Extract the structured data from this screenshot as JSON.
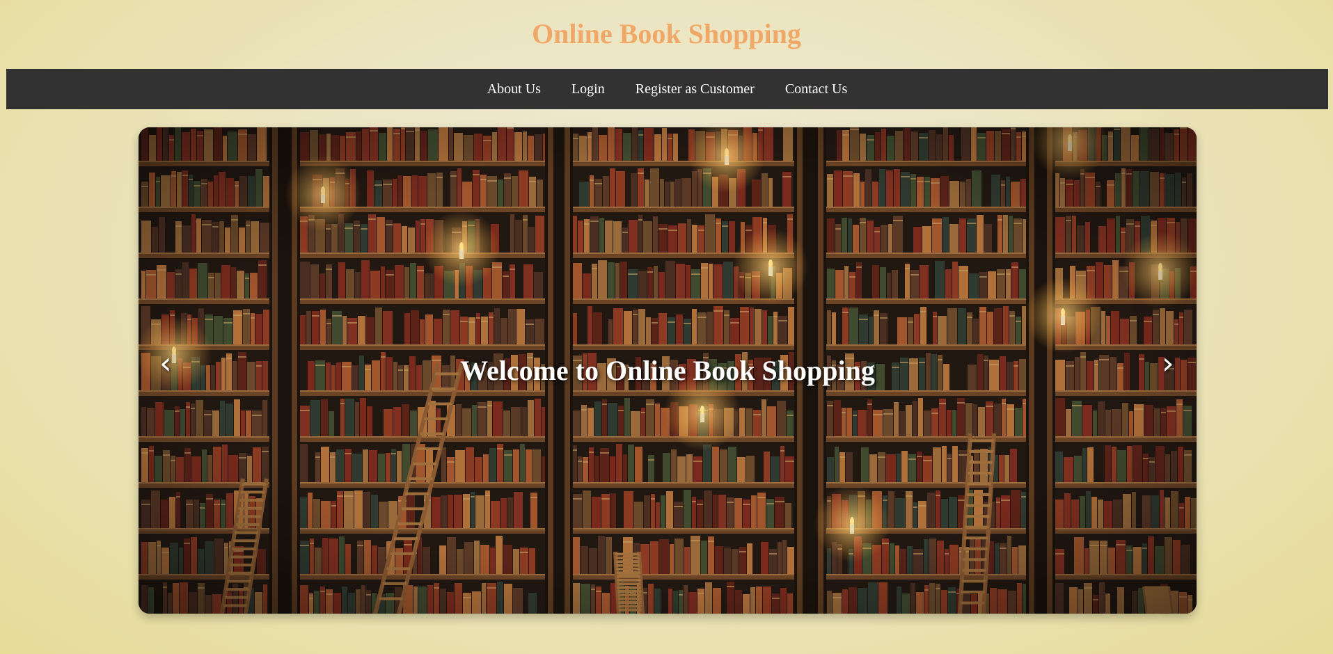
{
  "header": {
    "title": "Online Book Shopping"
  },
  "nav": {
    "items": [
      {
        "label": "About Us"
      },
      {
        "label": "Login"
      },
      {
        "label": "Register as Customer"
      },
      {
        "label": "Contact Us"
      }
    ]
  },
  "hero": {
    "caption": "Welcome to Online Book Shopping",
    "prev_icon": "‹",
    "next_icon": "›"
  },
  "colors": {
    "title": "#f0a868",
    "navbar": "#323232",
    "nav_text": "#ffffff",
    "page_bg": "#ece5c2"
  }
}
